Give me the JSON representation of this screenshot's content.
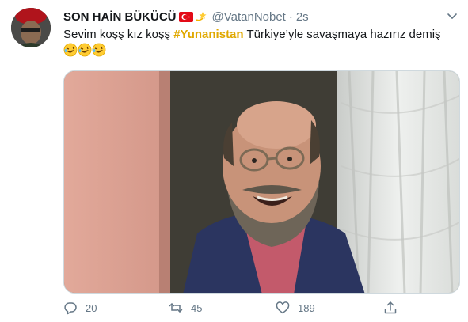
{
  "tweet": {
    "display_name": "SON HAİN BÜKÜCÜ",
    "handle": "@VatanNobet",
    "separator": "·",
    "time": "2s",
    "text_before": "Sevim koşş kız koşş ",
    "hashtag": "#Yunanistan",
    "text_after": " Türkiye’yle savaşmaya hazırız demiş",
    "emoji": "rolling-on-floor-laughing-emoji x3"
  },
  "actions": {
    "reply_count": "20",
    "retweet_count": "45",
    "like_count": "189"
  },
  "colors": {
    "hashtag": "#e0a800",
    "muted": "#657786",
    "text": "#14171a"
  }
}
